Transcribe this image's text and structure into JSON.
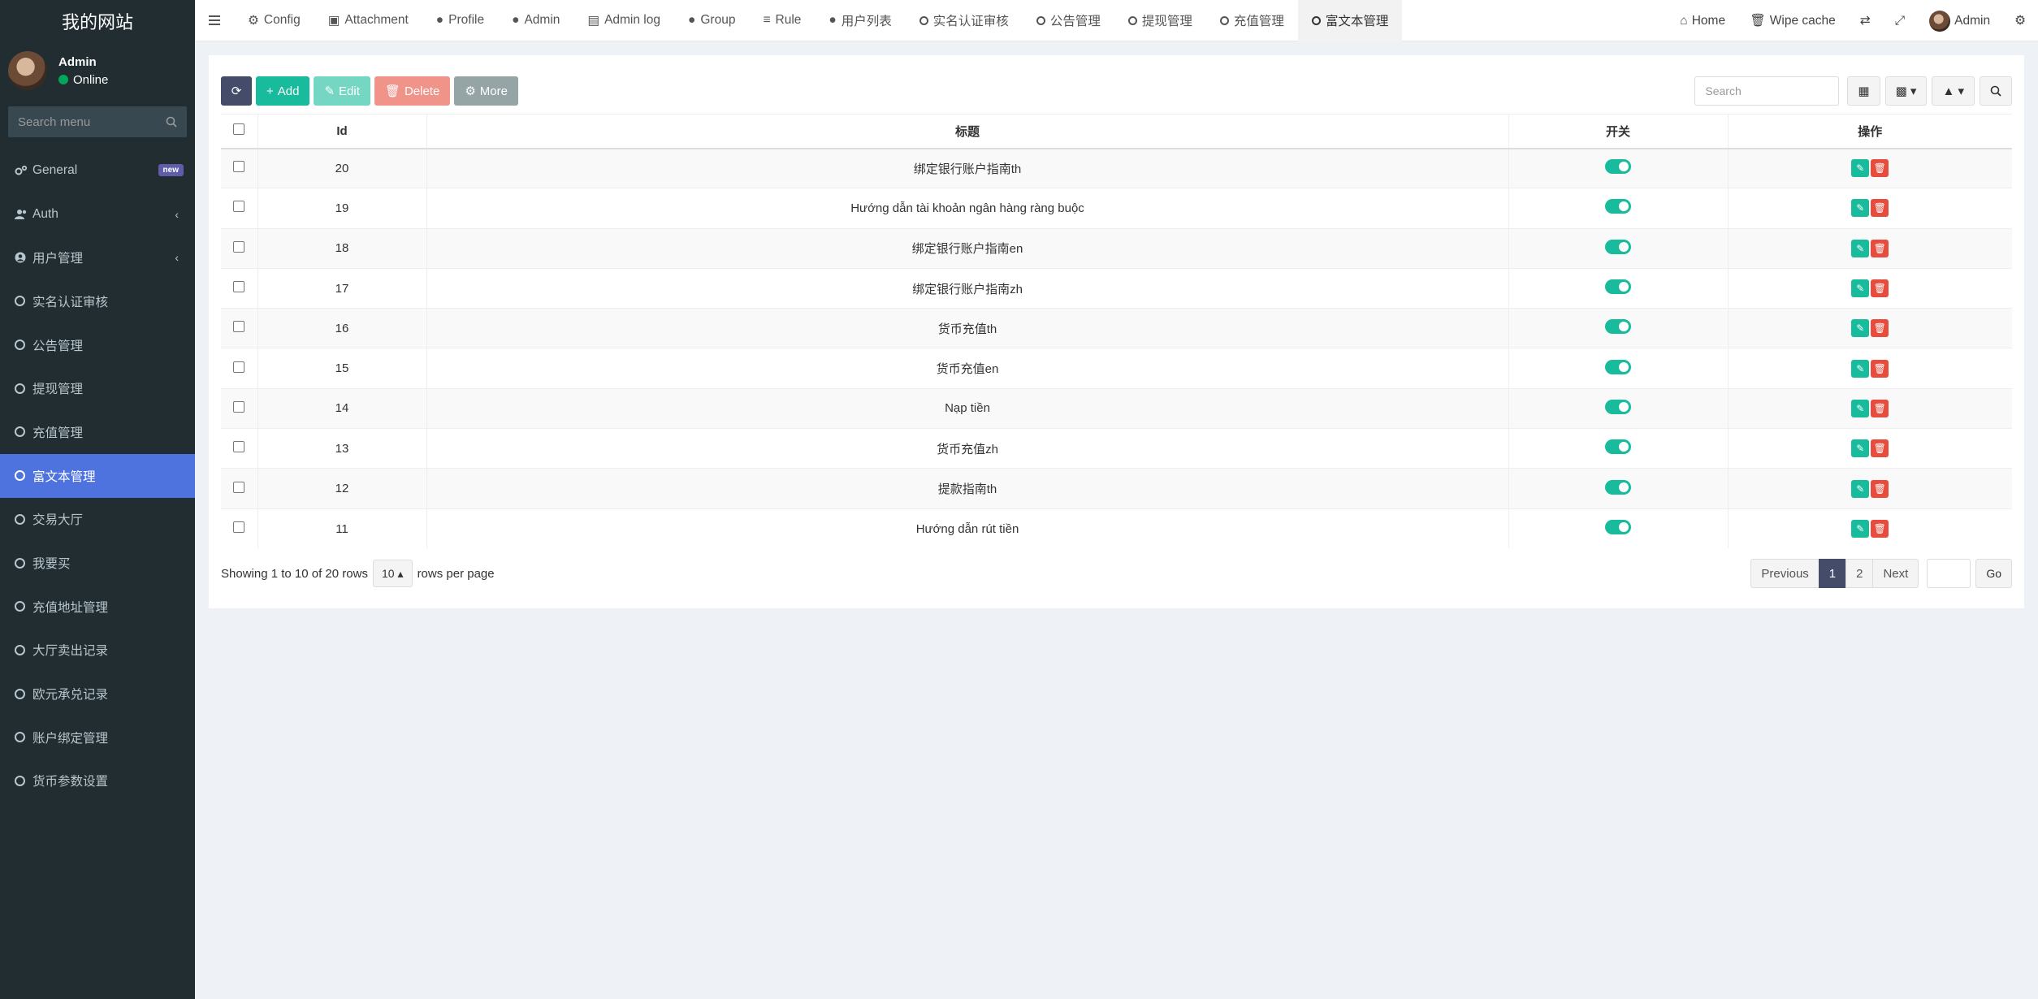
{
  "brand": "我的网站",
  "user": {
    "name": "Admin",
    "status": "Online"
  },
  "sidebar": {
    "search_placeholder": "Search menu",
    "items": [
      {
        "label": "General",
        "badge": "new"
      },
      {
        "label": "Auth"
      },
      {
        "label": "用户管理"
      },
      {
        "label": "实名认证审核"
      },
      {
        "label": "公告管理"
      },
      {
        "label": "提现管理"
      },
      {
        "label": "充值管理"
      },
      {
        "label": "富文本管理"
      },
      {
        "label": "交易大厅"
      },
      {
        "label": "我要买"
      },
      {
        "label": "充值地址管理"
      },
      {
        "label": "大厅卖出记录"
      },
      {
        "label": "欧元承兑记录"
      },
      {
        "label": "账户绑定管理"
      },
      {
        "label": "货币参数设置"
      }
    ]
  },
  "topnav": {
    "tabs": [
      "Config",
      "Attachment",
      "Profile",
      "Admin",
      "Admin log",
      "Group",
      "Rule",
      "用户列表",
      "实名认证审核",
      "公告管理",
      "提现管理",
      "充值管理",
      "富文本管理"
    ],
    "home": "Home",
    "wipe_cache": "Wipe cache",
    "admin": "Admin"
  },
  "toolbar": {
    "add": "Add",
    "edit": "Edit",
    "delete": "Delete",
    "more": "More",
    "search_placeholder": "Search"
  },
  "table": {
    "headers": {
      "id": "Id",
      "title": "标题",
      "switch": "开关",
      "ops": "操作"
    },
    "rows": [
      {
        "id": "20",
        "title": "绑定银行账户指南th"
      },
      {
        "id": "19",
        "title": "Hướng dẫn tài khoản ngân hàng ràng buộc"
      },
      {
        "id": "18",
        "title": "绑定银行账户指南en"
      },
      {
        "id": "17",
        "title": "绑定银行账户指南zh"
      },
      {
        "id": "16",
        "title": "货币充值th"
      },
      {
        "id": "15",
        "title": "货币充值en"
      },
      {
        "id": "14",
        "title": "Nạp tiền"
      },
      {
        "id": "13",
        "title": "货币充值zh"
      },
      {
        "id": "12",
        "title": "提款指南th"
      },
      {
        "id": "11",
        "title": "Hướng dẫn rút tiền"
      }
    ]
  },
  "footer": {
    "showing": "Showing 1 to 10 of 20 rows",
    "page_size": "10",
    "rows_per_page": "rows per page",
    "previous": "Previous",
    "pages": [
      "1",
      "2"
    ],
    "next": "Next",
    "go": "Go"
  }
}
